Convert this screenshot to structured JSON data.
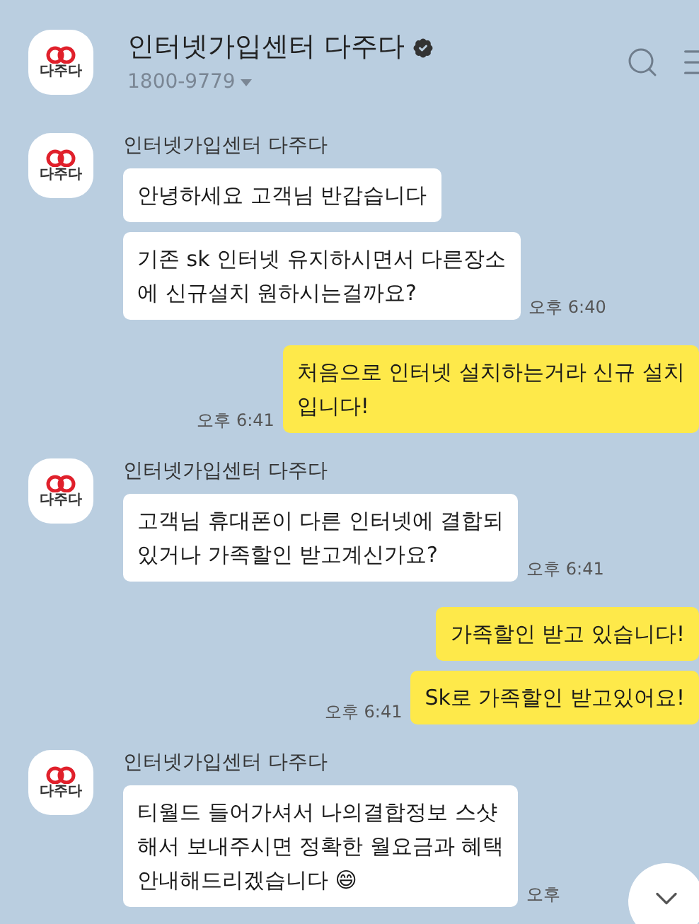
{
  "header": {
    "avatar_text": "다주다",
    "title": "인터넷가입센터 다주다",
    "phone": "1800-9779"
  },
  "messages": [
    {
      "kind": "received",
      "avatar_text": "다주다",
      "sender": "인터넷가입센터 다주다",
      "bubbles": [
        "안녕하세요 고객님 반갑습니다",
        "기존 sk 인터넷 유지하시면서 다른장소\n에 신규설치 원하시는걸까요?"
      ],
      "time": "오후 6:40"
    },
    {
      "kind": "sent",
      "bubbles": [
        "처음으로 인터넷 설치하는거라 신규 설치\n입니다!"
      ],
      "time": "오후 6:41"
    },
    {
      "kind": "received",
      "avatar_text": "다주다",
      "sender": "인터넷가입센터 다주다",
      "bubbles": [
        "고객님 휴대폰이 다른 인터넷에 결합되\n있거나 가족할인 받고계신가요?"
      ],
      "time": "오후 6:41"
    },
    {
      "kind": "sent",
      "bubbles": [
        "가족할인 받고 있습니다!",
        "Sk로 가족할인 받고있어요!"
      ],
      "time": "오후 6:41"
    },
    {
      "kind": "received",
      "avatar_text": "다주다",
      "sender": "인터넷가입센터 다주다",
      "bubbles": [
        "티월드 들어가셔서 나의결합정보 스샷\n해서 보내주시면 정확한 월요금과 혜택\n안내해드리겠습니다 😄"
      ],
      "time": "오후"
    }
  ]
}
